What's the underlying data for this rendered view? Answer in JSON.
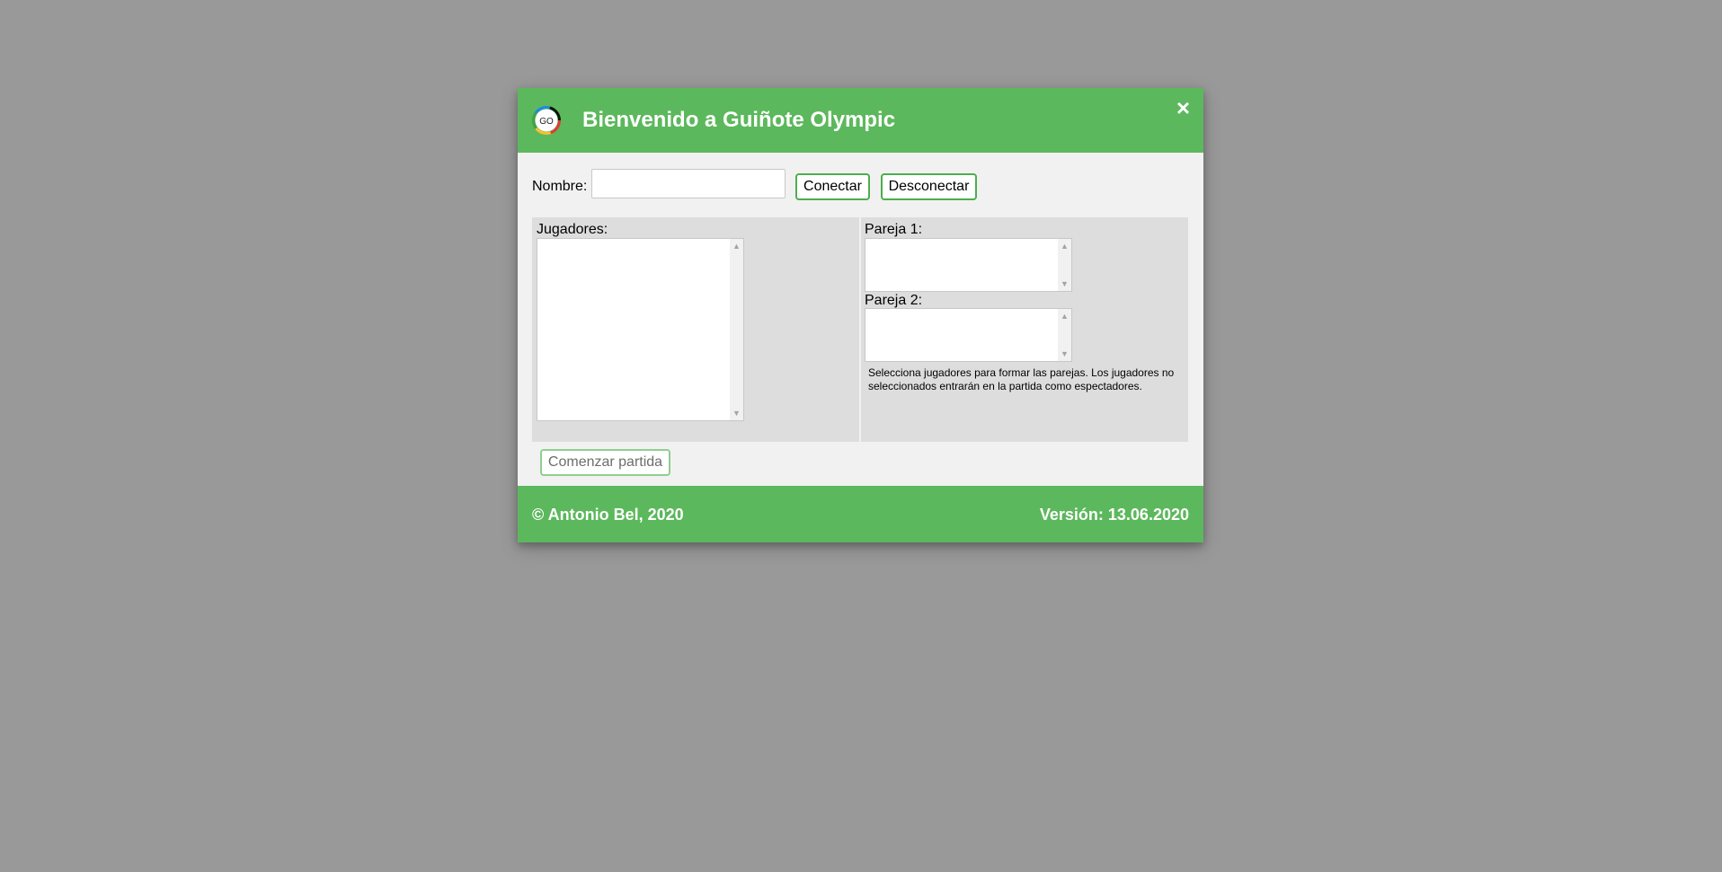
{
  "header": {
    "title": "Bienvenido a Guiñote Olympic",
    "logo_text": "GO",
    "close_symbol": "×"
  },
  "connect": {
    "name_label": "Nombre:",
    "name_value": "",
    "connect_label": "Conectar",
    "disconnect_label": "Desconectar"
  },
  "players": {
    "label": "Jugadores:"
  },
  "teams": {
    "pair1_label": "Pareja 1:",
    "pair2_label": "Pareja 2:",
    "hint": "Selecciona jugadores para formar las parejas. Los jugadores no seleccionados entrarán en la partida como espectadores."
  },
  "actions": {
    "start_label": "Comenzar partida"
  },
  "footer": {
    "copyright": "© Antonio Bel, 2020",
    "version": "Versión: 13.06.2020"
  },
  "colors": {
    "brand_green": "#5cb85c",
    "overlay": "#999999"
  }
}
